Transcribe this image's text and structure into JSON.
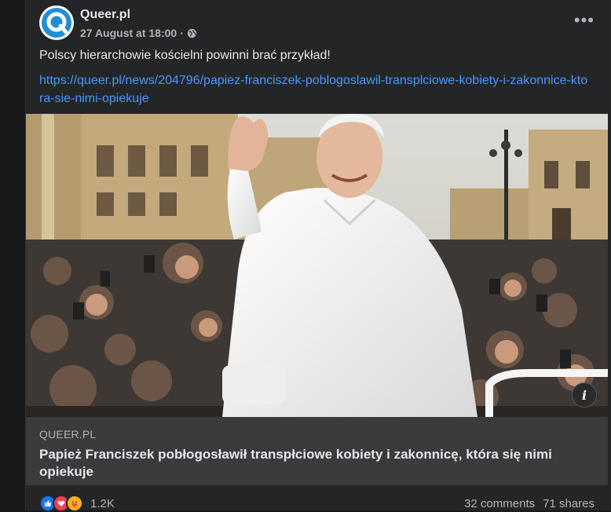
{
  "post": {
    "author": "Queer.pl",
    "timestamp": "27 August at 18:00",
    "separator": "·",
    "privacy_icon": "globe-icon",
    "text": "Polscy hierarchowie kościelni powinni brać przykład!",
    "link": "https://queer.pl/news/204796/papiez-franciszek-poblogoslawil-transplciowe-kobiety-i-zakonnice-ktora-sie-nimi-opiekuje"
  },
  "preview": {
    "domain": "QUEER.PL",
    "headline": "Papież Franciszek pobłogosławił transpłciowe kobiety i zakonnicę, która się nimi opiekuje"
  },
  "footer": {
    "reaction_icons": [
      "like-icon",
      "love-icon",
      "care-icon"
    ],
    "reaction_count": "1.2K",
    "comments": "32 comments",
    "shares": "71 shares"
  },
  "colors": {
    "background": "#18191a",
    "card": "#242526",
    "link": "#4599ff",
    "brand": "#1e8fd6"
  }
}
